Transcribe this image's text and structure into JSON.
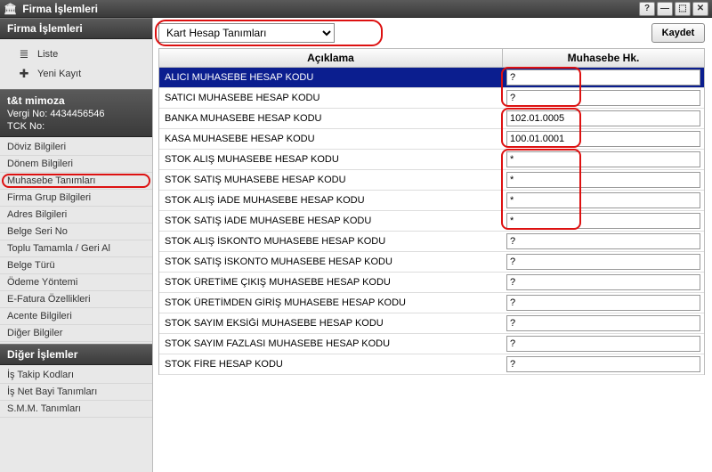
{
  "window": {
    "title": "Firma İşlemleri",
    "buttons": {
      "help": "?",
      "min": "—",
      "max": "⬚",
      "close": "✕"
    }
  },
  "sidebar": {
    "header1": "Firma İşlemleri",
    "nav": [
      {
        "icon": "≣",
        "label": "Liste"
      },
      {
        "icon": "✚",
        "label": "Yeni Kayıt"
      }
    ],
    "company": {
      "name": "t&t mimoza",
      "vergi_label": "Vergi No:",
      "vergi_no": "4434456546",
      "tck_label": "TCK No:",
      "tck_no": ""
    },
    "menu": [
      {
        "label": "Döviz Bilgileri",
        "active": false
      },
      {
        "label": "Dönem Bilgileri",
        "active": false
      },
      {
        "label": "Muhasebe Tanımları",
        "active": true
      },
      {
        "label": "Firma Grup Bilgileri",
        "active": false
      },
      {
        "label": "Adres Bilgileri",
        "active": false
      },
      {
        "label": "Belge Seri No",
        "active": false
      },
      {
        "label": "Toplu Tamamla / Geri Al",
        "active": false
      },
      {
        "label": "Belge Türü",
        "active": false
      },
      {
        "label": "Ödeme Yöntemi",
        "active": false
      },
      {
        "label": "E-Fatura Özellikleri",
        "active": false
      },
      {
        "label": "Acente Bilgileri",
        "active": false
      },
      {
        "label": "Diğer Bilgiler",
        "active": false
      }
    ],
    "header2": "Diğer İşlemler",
    "menu2": [
      {
        "label": "İş Takip Kodları"
      },
      {
        "label": "İş Net Bayi Tanımları"
      },
      {
        "label": "S.M.M. Tanımları"
      }
    ]
  },
  "main": {
    "dropdown_value": "Kart Hesap Tanımları",
    "save_label": "Kaydet",
    "columns": {
      "aciklama": "Açıklama",
      "muh": "Muhasebe Hk."
    },
    "rows": [
      {
        "label": "ALICI MUHASEBE HESAP KODU",
        "value": "?",
        "selected": true,
        "hl": 1
      },
      {
        "label": "SATICI MUHASEBE HESAP KODU",
        "value": "?",
        "hl": 1
      },
      {
        "label": "BANKA MUHASEBE HESAP KODU",
        "value": "102.01.0005",
        "hl": 2
      },
      {
        "label": "KASA MUHASEBE HESAP KODU",
        "value": "100.01.0001",
        "hl": 2
      },
      {
        "label": "STOK ALIŞ MUHASEBE HESAP KODU",
        "value": "*",
        "hl": 3
      },
      {
        "label": "STOK SATIŞ MUHASEBE HESAP KODU",
        "value": "*",
        "hl": 3
      },
      {
        "label": "STOK ALIŞ İADE MUHASEBE HESAP KODU",
        "value": "*",
        "hl": 3
      },
      {
        "label": "STOK SATIŞ İADE MUHASEBE HESAP KODU",
        "value": "*",
        "hl": 3
      },
      {
        "label": "STOK ALIŞ İSKONTO MUHASEBE HESAP KODU",
        "value": "?"
      },
      {
        "label": "STOK SATIŞ İSKONTO MUHASEBE HESAP KODU",
        "value": "?"
      },
      {
        "label": "STOK ÜRETİME ÇIKIŞ MUHASEBE HESAP KODU",
        "value": "?"
      },
      {
        "label": "STOK ÜRETİMDEN GİRİŞ MUHASEBE HESAP KODU",
        "value": "?"
      },
      {
        "label": "STOK SAYIM EKSİĞİ MUHASEBE HESAP KODU",
        "value": "?"
      },
      {
        "label": "STOK SAYIM FAZLASI MUHASEBE HESAP KODU",
        "value": "?"
      },
      {
        "label": "STOK FİRE HESAP KODU",
        "value": "?"
      }
    ]
  },
  "highlights": {
    "dropdown": true,
    "menu_active_index": 2,
    "groups": [
      {
        "id": 1,
        "from": 0,
        "to": 1,
        "col": "value"
      },
      {
        "id": 2,
        "from": 2,
        "to": 3,
        "col": "value"
      },
      {
        "id": 3,
        "from": 4,
        "to": 7,
        "col": "value"
      }
    ]
  }
}
